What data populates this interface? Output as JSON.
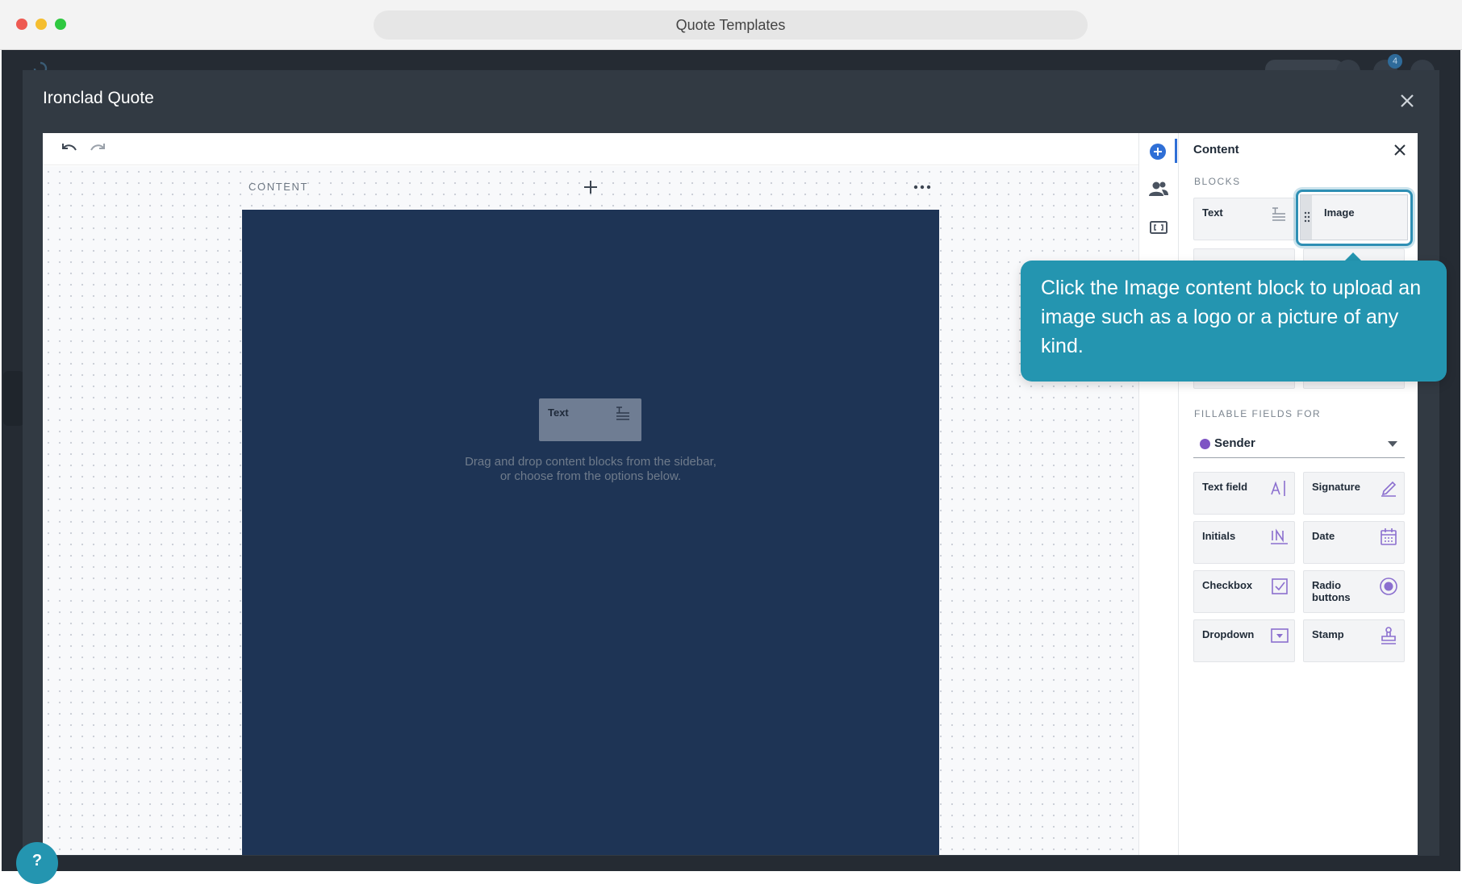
{
  "window": {
    "title": "Quote Templates"
  },
  "modal": {
    "title": "Ironclad Quote"
  },
  "editor": {
    "section_label": "CONTENT",
    "drop_block_label": "Text",
    "drop_hint": "Drag and drop content blocks from the sidebar,\nor choose from the options below."
  },
  "panel": {
    "title": "Content",
    "blocks_label": "BLOCKS",
    "blocks": [
      {
        "label": "Text",
        "icon": "text-block-icon"
      },
      {
        "label": "Image",
        "icon": "drag-handle-icon"
      }
    ],
    "fillable_label": "FILLABLE FIELDS FOR",
    "sender": "Sender",
    "fields": [
      {
        "label": "Text field",
        "icon": "text-field-icon"
      },
      {
        "label": "Signature",
        "icon": "pen-icon"
      },
      {
        "label": "Initials",
        "icon": "initials-icon"
      },
      {
        "label": "Date",
        "icon": "calendar-icon"
      },
      {
        "label": "Checkbox",
        "icon": "checkbox-icon"
      },
      {
        "label": "Radio\nbuttons",
        "icon": "radio-icon"
      },
      {
        "label": "Dropdown",
        "icon": "dropdown-icon"
      },
      {
        "label": "Stamp",
        "icon": "stamp-icon"
      }
    ]
  },
  "tooltip": {
    "text": "Click the Image content block to upload an image such as a logo or a picture of any kind."
  },
  "notification_count": "4",
  "help": "?",
  "colors": {
    "accent": "#2495b0",
    "page": "#1e3455",
    "sender_dot": "#7e54c4"
  }
}
